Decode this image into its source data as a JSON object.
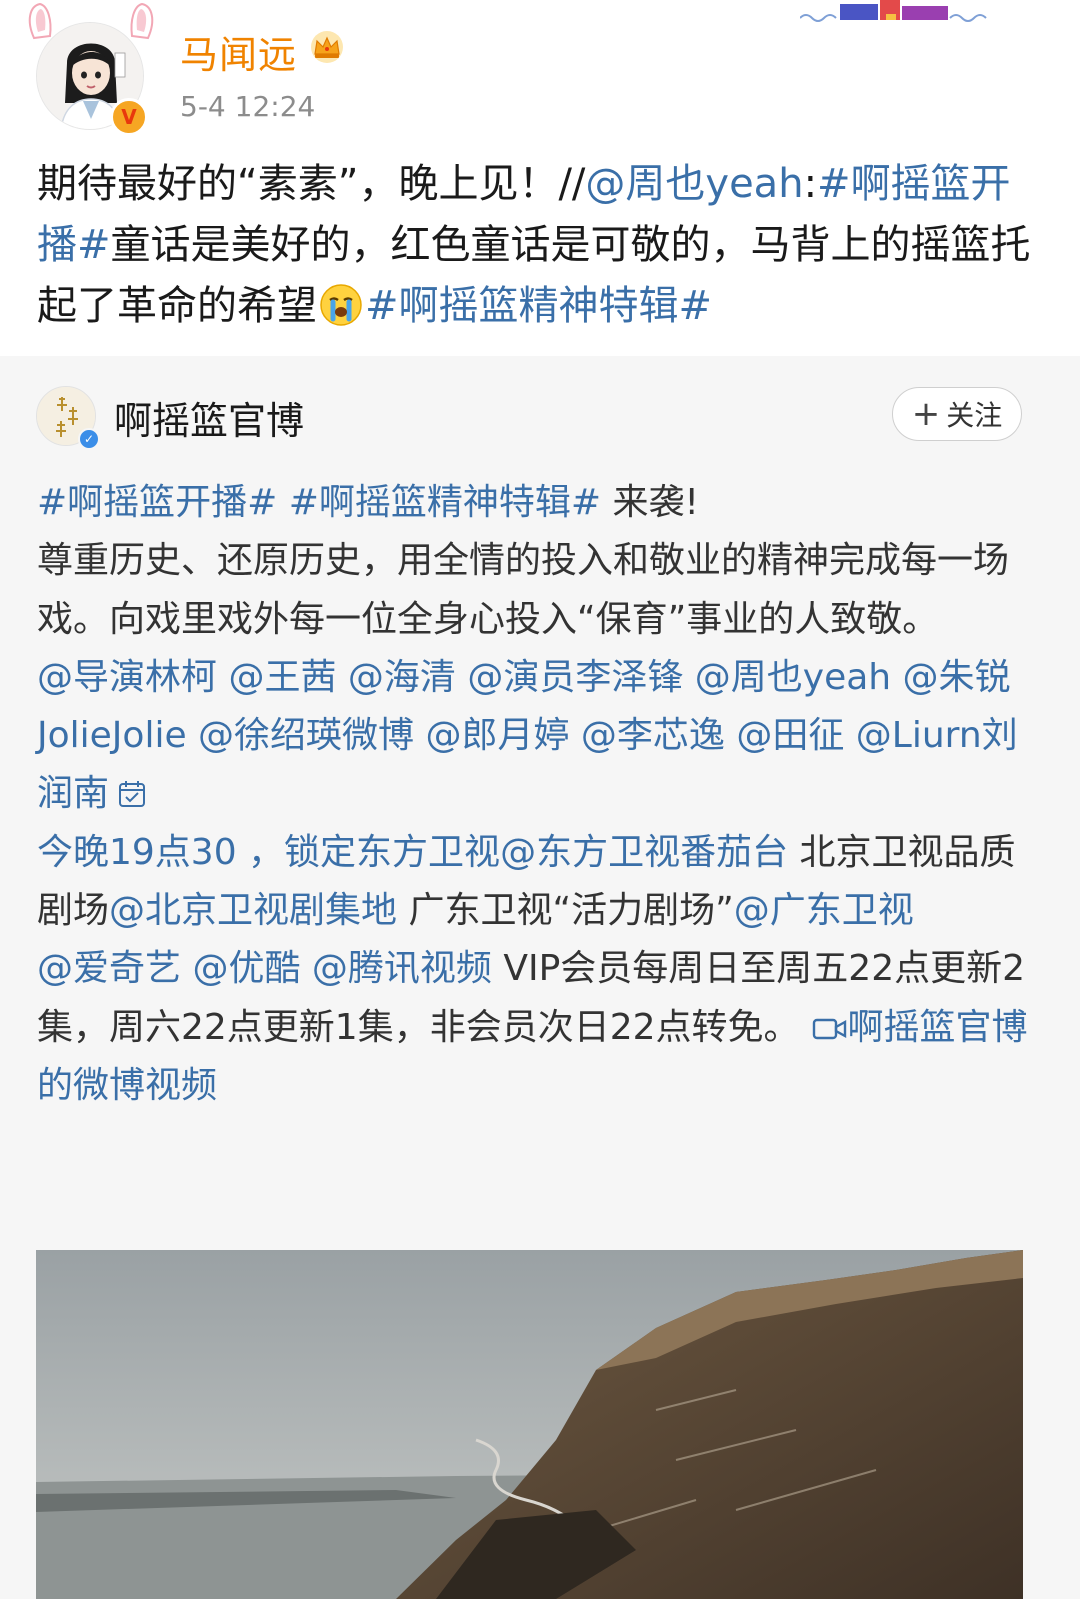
{
  "post": {
    "username": "马闻远",
    "time": "5-4 12:24",
    "text_before": "期待最好的“素素”，晚上见！//",
    "mention_zhouye": "@周也yeah",
    "colon": ":",
    "topic_launch": "#啊摇篮开播#",
    "text_mid": "童话是美好的，红色童话是可敬的，马背上的摇篮托起了革命的希望",
    "topic_special": "#啊摇篮精神特辑#"
  },
  "repost": {
    "account_name": "啊摇篮官博",
    "follow_label": "关注",
    "follow_plus": "+",
    "topics_line": "#啊摇篮开播# #啊摇篮精神特辑#",
    "arrive_text": " 来袭!",
    "body_text": "尊重历史、还原历史，用全情的投入和敬业的精神完成每一场戏。向戏里戏外每一位全身心投入“保育”事业的人致敬。",
    "mentions_cast": "@导演林柯 @王茜 @海清 @演员李泽锋 @周也yeah @朱锐JolieJolie @徐绍瑛微博 @郎月婷 @李芯逸 @田征 @Liurn刘润南",
    "schedule_1": "今晚19点30 ，锁定东方卫视",
    "mention_dragon": "@东方卫视番茄台",
    "schedule_2": " 北京卫视品质剧场",
    "mention_bjtv": "@北京卫视剧集地",
    "schedule_3": " 广东卫视“活力剧场”",
    "mention_gdtv": "@广东卫视",
    "mentions_platforms": "@爱奇艺 @优酷 @腾讯视频",
    "vip_text": " VIP会员每周日至周五22点更新2集，周六22点更新1集，非会员次日22点转免。",
    "video_link": "啊摇篮官博的微博视频"
  },
  "colors": {
    "username": "#f08300",
    "link": "#3a6fa8",
    "card_bg": "#f6f6f6"
  },
  "icons": [
    "crown-icon",
    "verified-badge-icon",
    "crying-emoji-icon",
    "calendar-check-icon",
    "video-icon",
    "plus-icon"
  ]
}
